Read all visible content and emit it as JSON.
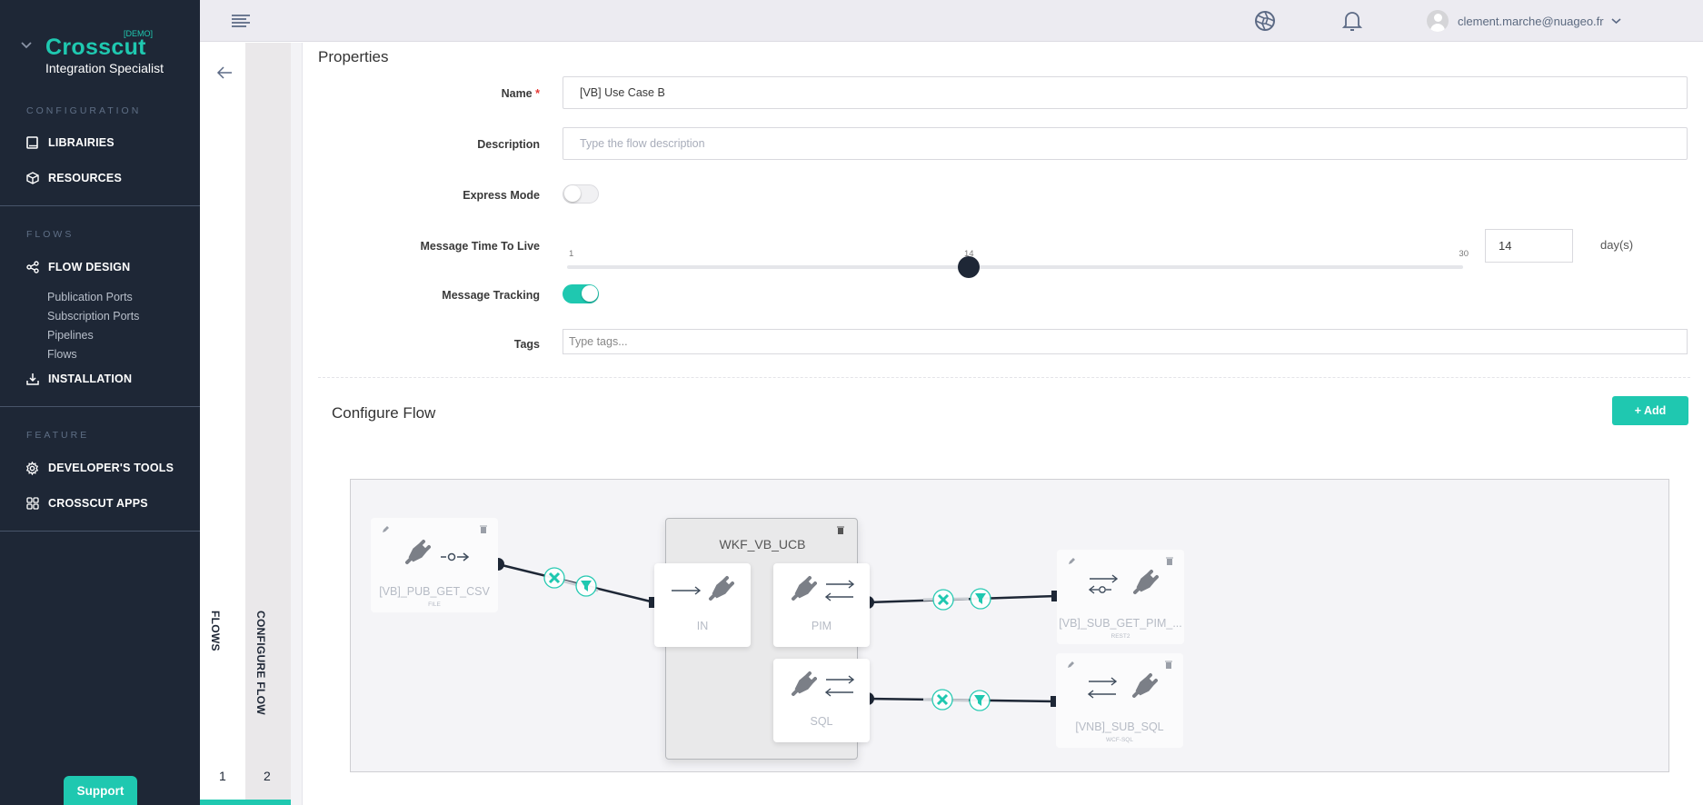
{
  "sidebar": {
    "brand": {
      "name": "Crosscut",
      "badge": "[DEMO]",
      "subtitle": "Integration Specialist"
    },
    "sections": [
      {
        "label": "CONFIGURATION"
      },
      {
        "label": "FLOWS"
      },
      {
        "label": "FEATURE"
      }
    ],
    "items": [
      {
        "label": "LIBRAIRIES",
        "icon": "book-icon"
      },
      {
        "label": "RESOURCES",
        "icon": "cube-icon"
      },
      {
        "label": "FLOW DESIGN",
        "icon": "share-nodes-icon"
      },
      {
        "label": "INSTALLATION",
        "icon": "download-icon"
      },
      {
        "label": "DEVELOPER'S TOOLS",
        "icon": "gear-icon"
      },
      {
        "label": "CROSSCUT APPS",
        "icon": "grid-icon"
      }
    ],
    "flow_design_sub": [
      "Publication Ports",
      "Subscription Ports",
      "Pipelines",
      "Flows"
    ],
    "support_label": "Support"
  },
  "topbar": {
    "user_email": "clement.marche@nuageo.fr"
  },
  "wizard": {
    "steps": [
      {
        "label": "FLOWS",
        "number": "1"
      },
      {
        "label": "CONFIGURE FLOW",
        "number": "2"
      }
    ],
    "active_step": 2
  },
  "properties": {
    "title": "Properties",
    "name_label": "Name",
    "name_required": "*",
    "name_value": "[VB] Use Case B",
    "description_label": "Description",
    "description_placeholder": "Type the flow description",
    "description_value": "",
    "express_mode_label": "Express Mode",
    "express_mode": false,
    "ttl_label": "Message Time To Live",
    "ttl_min": 1,
    "ttl_max": 30,
    "ttl_value": 14,
    "ttl_min_label": "1",
    "ttl_max_label": "30",
    "ttl_value_label": "14",
    "ttl_input": "14",
    "ttl_unit": "day(s)",
    "tracking_label": "Message Tracking",
    "tracking": true,
    "tags_label": "Tags",
    "tags_placeholder": "Type tags..."
  },
  "configure_flow": {
    "title": "Configure Flow",
    "add_label": "+ Add",
    "colors": {
      "accent": "#1fc8b0",
      "link": "#1e2736"
    },
    "publication": {
      "name": "[VB]_PUB_GET_CSV",
      "type": "FILE"
    },
    "pipeline": {
      "name": "WKF_VB_UCB",
      "steps": [
        {
          "name": "IN"
        },
        {
          "name": "PIM"
        },
        {
          "name": "SQL"
        }
      ]
    },
    "subscriptions": [
      {
        "name": "[VB]_SUB_GET_PIM_...",
        "type": "REST2"
      },
      {
        "name": "[VNB]_SUB_SQL",
        "type": "WCF-SQL"
      }
    ]
  }
}
